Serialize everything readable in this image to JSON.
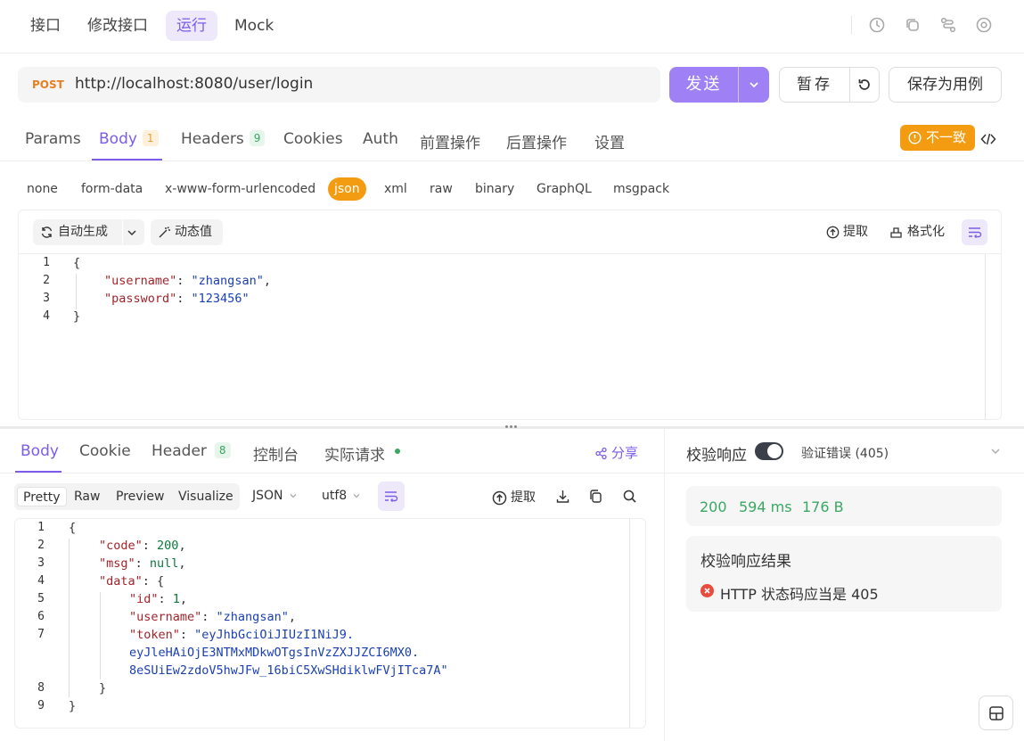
{
  "top_tabs": [
    "接口",
    "修改接口",
    "运行",
    "Mock"
  ],
  "request": {
    "method": "POST",
    "url": "http://localhost:8080/user/login",
    "send_label": "发送",
    "save_label": "暂存",
    "save_as_case_label": "保存为用例"
  },
  "req_tabs": {
    "params": "Params",
    "body": "Body",
    "body_count": "1",
    "headers": "Headers",
    "headers_count": "9",
    "cookies": "Cookies",
    "auth": "Auth",
    "pre": "前置操作",
    "post": "后置操作",
    "settings": "设置"
  },
  "inconsistent_label": "不一致",
  "body_types": [
    "none",
    "form-data",
    "x-www-form-urlencoded",
    "json",
    "xml",
    "raw",
    "binary",
    "GraphQL",
    "msgpack"
  ],
  "editor_toolbar": {
    "auto_generate": "自动生成",
    "dynamic_value": "动态值",
    "extract": "提取",
    "format": "格式化"
  },
  "request_body": {
    "line_numbers": [
      "1",
      "2",
      "3",
      "4"
    ],
    "open": "{",
    "username_key": "\"username\"",
    "username_val": "\"zhangsan\"",
    "password_key": "\"password\"",
    "password_val": "\"123456\"",
    "close": "}"
  },
  "resp_tabs": {
    "body": "Body",
    "cookie": "Cookie",
    "header": "Header",
    "header_count": "8",
    "console": "控制台",
    "actual_request": "实际请求",
    "share": "分享"
  },
  "view_modes": [
    "Pretty",
    "Raw",
    "Preview",
    "Visualize"
  ],
  "format_select": "JSON",
  "encoding_select": "utf8",
  "resp_toolbar": {
    "extract": "提取"
  },
  "response_body": {
    "line_numbers": [
      "1",
      "2",
      "3",
      "4",
      "5",
      "6",
      "7",
      "",
      "",
      "8",
      "9"
    ],
    "code_key": "\"code\"",
    "code_val": "200",
    "msg_key": "\"msg\"",
    "msg_val": "null",
    "data_key": "\"data\"",
    "id_key": "\"id\"",
    "id_val": "1",
    "username_key": "\"username\"",
    "username_val": "\"zhangsan\"",
    "token_key": "\"token\"",
    "token_line1": "\"eyJhbGciOiJIUzI1NiJ9.",
    "token_line2": "eyJleHAiOjE3NTMxMDkwOTgsInVzZXJJZCI6MX0.",
    "token_line3": "8eSUiEw2zdoV5hwJFw_16biC5XwSHdiklwFVjITca7A\""
  },
  "validation": {
    "label": "校验响应",
    "toggle_on": true,
    "error_text": "验证错误 (405)",
    "status": "200",
    "time": "594 ms",
    "size": "176 B",
    "result_title": "校验响应结果",
    "result_item": "HTTP 状态码应当是 405"
  },
  "colors": {
    "accent": "#7c5ce8",
    "send_button": "#9f80f5",
    "warning": "#f39c12",
    "success": "#3aa862",
    "error": "#e74c3c"
  }
}
